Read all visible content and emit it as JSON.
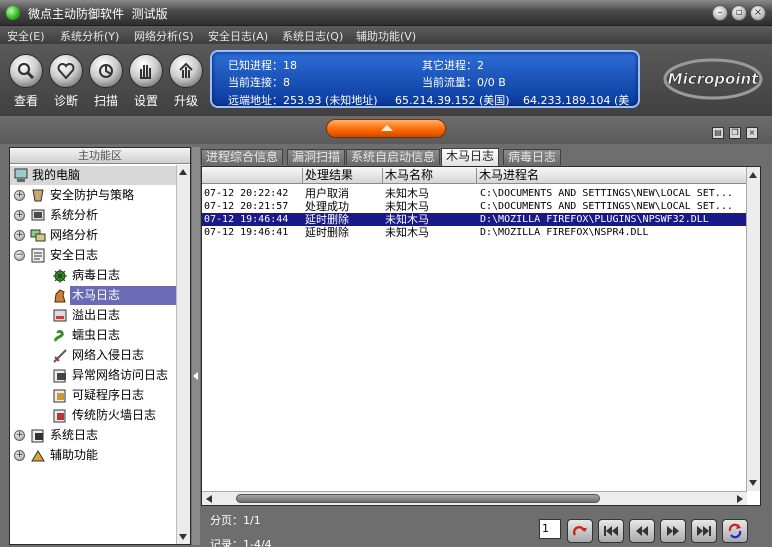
{
  "window": {
    "title": "微点主动防御软件  测试版"
  },
  "menu": {
    "items": [
      "安全(E)",
      "系统分析(Y)",
      "网络分析(S)",
      "安全日志(A)",
      "系统日志(Q)",
      "辅助功能(V)"
    ]
  },
  "toolbar": {
    "buttons": [
      "查看",
      "诊断",
      "扫描",
      "设置",
      "升级"
    ]
  },
  "status": {
    "known_process_label": "已知进程：18",
    "other_process_label": "其它进程：2",
    "current_conn_label": "当前连接：8",
    "current_traffic_label": "当前流量：0/0 B",
    "remote_addr_label": "远端地址：253.93 (未知地址)",
    "remote_addr_2": "65.214.39.152 (美国)",
    "remote_addr_3": "64.233.189.104 (美"
  },
  "brand": {
    "name": "Micropoint"
  },
  "left_panel": {
    "header": "主功能区",
    "tree": [
      {
        "label": "我的电脑",
        "icon": "computer-icon"
      },
      {
        "label": "安全防护与策略",
        "icon": "shield-policy-icon"
      },
      {
        "label": "系统分析",
        "icon": "system-analysis-icon"
      },
      {
        "label": "网络分析",
        "icon": "network-analysis-icon"
      },
      {
        "label": "安全日志",
        "icon": "security-log-icon"
      },
      {
        "label": "病毒日志",
        "icon": "virus-icon"
      },
      {
        "label": "木马日志",
        "icon": "trojan-horse-icon"
      },
      {
        "label": "溢出日志",
        "icon": "overflow-icon"
      },
      {
        "label": "蠕虫日志",
        "icon": "worm-icon"
      },
      {
        "label": "网络入侵日志",
        "icon": "sword-icon"
      },
      {
        "label": "异常网络访问日志",
        "icon": "network-log-icon"
      },
      {
        "label": "可疑程序日志",
        "icon": "suspicious-program-icon"
      },
      {
        "label": "传统防火墙日志",
        "icon": "firewall-icon"
      },
      {
        "label": "系统日志",
        "icon": "system-log-icon"
      },
      {
        "label": "辅助功能",
        "icon": "auxiliary-icon"
      }
    ]
  },
  "tabs": [
    "进程综合信息",
    "漏洞扫描",
    "系统自启动信息",
    "木马日志",
    "病毒日志"
  ],
  "active_tab": "木马日志",
  "table": {
    "columns": [
      "",
      "处理结果",
      "木马名称",
      "木马进程名"
    ],
    "rows": [
      {
        "time": "07-12 20:22:42",
        "result": "用户取消",
        "name": "未知木马",
        "process": "C:\\DOCUMENTS AND SETTINGS\\NEW\\LOCAL SET..."
      },
      {
        "time": "07-12 20:21:57",
        "result": "处理成功",
        "name": "未知木马",
        "process": "C:\\DOCUMENTS AND SETTINGS\\NEW\\LOCAL SET..."
      },
      {
        "time": "07-12 19:46:44",
        "result": "延时删除",
        "name": "未知木马",
        "process": "D:\\MOZILLA FIREFOX\\PLUGINS\\NPSWF32.DLL"
      },
      {
        "time": "07-12 19:46:41",
        "result": "延时删除",
        "name": "未知木马",
        "process": "D:\\MOZILLA FIREFOX\\NSPR4.DLL"
      }
    ]
  },
  "footer": {
    "page_label": "分页：1/1",
    "record_label": "记录：1-4/4",
    "page_value": "1"
  }
}
